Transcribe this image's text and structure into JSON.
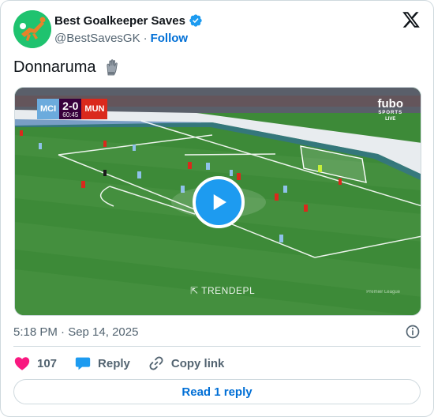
{
  "author": {
    "display_name": "Best Goalkeeper Saves",
    "handle": "@BestSavesGK",
    "separator": "·",
    "follow_label": "Follow",
    "verified": true
  },
  "tweet": {
    "text": "Donnaruma",
    "emoji_icon": "goalkeeper-glove-icon"
  },
  "video": {
    "home_team": "MCI",
    "score": "2-0",
    "clock": "60:45",
    "away_team": "MUN",
    "broadcaster": "fubo",
    "broadcaster_sub": "SPORTS",
    "broadcaster_live": "LIVE",
    "watermark": "TRENDEPL",
    "credit": "Premier League",
    "play_icon": "play-icon"
  },
  "meta": {
    "timestamp": "5:18 PM · Sep 14, 2025"
  },
  "actions": {
    "like_count": "107",
    "reply_label": "Reply",
    "copy_link_label": "Copy link"
  },
  "read_replies_label": "Read 1 reply",
  "colors": {
    "accent": "#1d9bf0",
    "link": "#006fd6",
    "like": "#f91880",
    "secondary_text": "#536471",
    "border": "#cfd9de"
  }
}
